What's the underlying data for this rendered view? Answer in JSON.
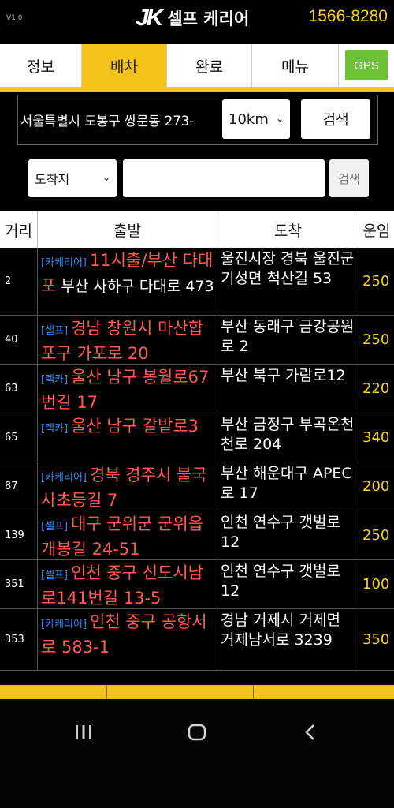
{
  "header": {
    "version": "V1.0",
    "logo_mark": "JK",
    "logo_text": "셀프 케리어",
    "phone": "1566-8280"
  },
  "tabs": [
    {
      "label": "정보",
      "active": false
    },
    {
      "label": "배차",
      "active": true
    },
    {
      "label": "완료",
      "active": false
    },
    {
      "label": "메뉴",
      "active": false
    },
    {
      "label": "GPS",
      "active": false
    }
  ],
  "search": {
    "address": "서울특별시 도봉구 쌍문동 273-",
    "distance": "10km",
    "search_label": "검색",
    "dest_select": "도착지",
    "dest_input": "",
    "search2_label": "검색"
  },
  "table": {
    "headers": [
      "거리",
      "출발",
      "도착",
      "운임"
    ],
    "rows": [
      {
        "dist": "2",
        "tag": "[카케리어]",
        "start_main": "11시출/부산 다대포",
        "start_sub": " 부산 사하구 다대로 473",
        "dest": "울진시장 경북 울진군 기성면 척산길 53",
        "fee": "250"
      },
      {
        "dist": "40",
        "tag": "[셀프]",
        "start_main": "경남 창원시 마산합포구 가포로 20",
        "start_sub": "",
        "dest": "부산 동래구 금강공원로 2",
        "fee": "250"
      },
      {
        "dist": "63",
        "tag": "[렉카]",
        "start_main": "울산 남구 봉월로67번길 17",
        "start_sub": "",
        "dest": "부산 북구 가람로12",
        "fee": "220"
      },
      {
        "dist": "65",
        "tag": "[렉카]",
        "start_main": "울산 남구 갈밭로3",
        "start_sub": "",
        "dest": "부산 금정구 부곡온천천로 204",
        "fee": "340"
      },
      {
        "dist": "87",
        "tag": "[카케리어]",
        "start_main": "경북 경주시 불국사초등길 7",
        "start_sub": "",
        "dest": "부산 해운대구 APEC로 17",
        "fee": "200"
      },
      {
        "dist": "139",
        "tag": "[셀프]",
        "start_main": "대구 군위군 군위읍 개봉길 24-51",
        "start_sub": "",
        "dest": "인천 연수구 갯벌로 12",
        "fee": "250"
      },
      {
        "dist": "351",
        "tag": "[셀프]",
        "start_main": "인천 중구 신도시남로141번길 13-5",
        "start_sub": "",
        "dest": "인천 연수구 갯벌로 12",
        "fee": "100"
      },
      {
        "dist": "353",
        "tag": "[카케리어]",
        "start_main": "인천 중구 공항서로 583-1",
        "start_sub": "",
        "dest": "경남 거제시 거제면 거제남서로 3239",
        "fee": "350"
      }
    ]
  },
  "navbar": {
    "recent_icon": "recent-apps-icon",
    "home_icon": "home-icon",
    "back_icon": "back-icon"
  },
  "colors": {
    "accent": "#f4c21a",
    "start_text": "#ff5a4e",
    "tag": "#2f8cf5",
    "fee": "#f3cf1d",
    "gps": "#6cc234"
  }
}
